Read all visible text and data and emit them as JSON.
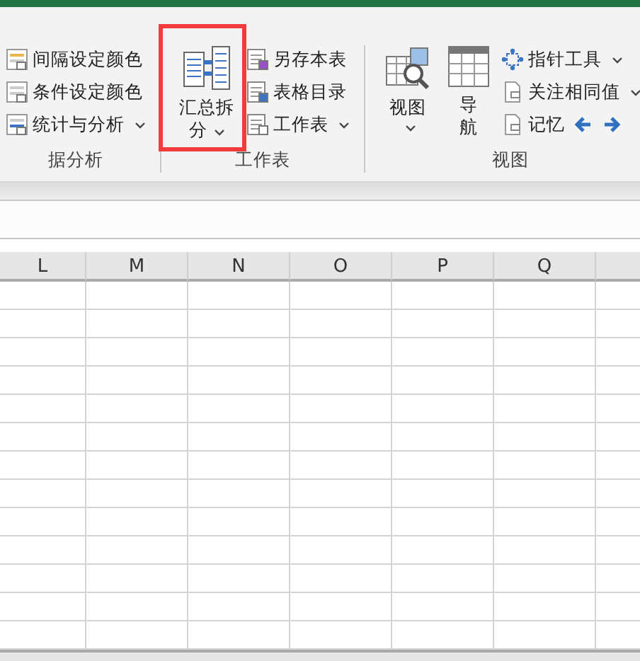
{
  "ribbon": {
    "groups": [
      {
        "label": "据分析",
        "items": [
          {
            "label": "间隔设定颜色",
            "dropdown": false,
            "kind": "plain"
          },
          {
            "label": "条件设定颜色",
            "dropdown": false,
            "kind": "plain"
          },
          {
            "label": "统计与分析",
            "dropdown": true,
            "kind": "plain"
          }
        ]
      },
      {
        "label": "工作表",
        "large_buttons": [
          {
            "label": "汇总拆分",
            "dropdown": true,
            "highlighted": true
          }
        ],
        "items": [
          {
            "label": "另存本表",
            "dropdown": false,
            "kind": "plain"
          },
          {
            "label": "表格目录",
            "dropdown": false,
            "kind": "plain"
          },
          {
            "label": "工作表",
            "dropdown": true,
            "kind": "plain"
          }
        ]
      },
      {
        "label": "视图",
        "large_buttons": [
          {
            "label": "视图",
            "dropdown": true,
            "highlighted": false
          },
          {
            "label": "导航",
            "dropdown": false,
            "highlighted": false
          }
        ],
        "items": [
          {
            "label": "指针工具",
            "dropdown": true,
            "kind": "plain"
          },
          {
            "label": "关注相同值",
            "dropdown": true,
            "kind": "plain"
          },
          {
            "label": "记忆",
            "dropdown": false,
            "kind": "with-arrows"
          }
        ]
      }
    ]
  },
  "sheet": {
    "columns": [
      "L",
      "M",
      "N",
      "O",
      "P",
      "Q"
    ]
  }
}
